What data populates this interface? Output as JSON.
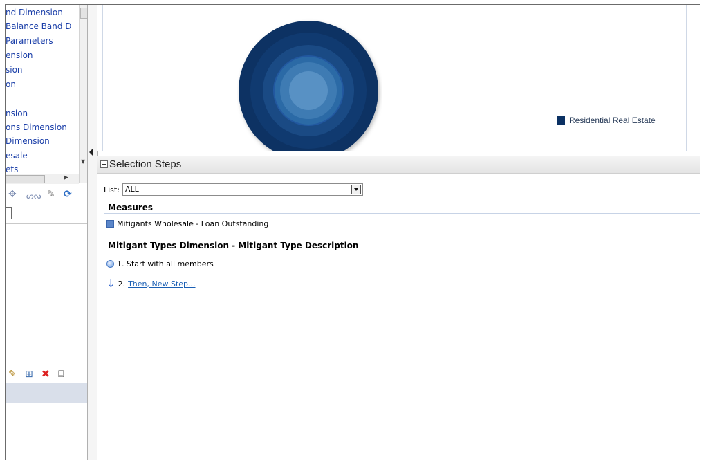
{
  "left_panel": {
    "tree_items": [
      "nd Dimension",
      "Balance Band D",
      "Parameters",
      "ension",
      "sion",
      "on",
      "",
      "nsion",
      "ons Dimension",
      "Dimension",
      "esale",
      "ets"
    ]
  },
  "chart_data": {
    "type": "pie",
    "categories": [
      "Residential Real Estate"
    ],
    "values": [
      100
    ],
    "legend_position": "right",
    "colors": [
      "#0b3163"
    ]
  },
  "legend": {
    "label": "Residential Real Estate"
  },
  "selection_steps": {
    "title": "Selection Steps",
    "list_label": "List:",
    "list_value": "ALL",
    "measures_heading": "Measures",
    "measure_item": "Mitigants Wholesale - Loan Outstanding",
    "dimension_heading": "Mitigant Types Dimension - Mitigant Type Description",
    "step1": "1. Start with all members",
    "step2_prefix": "2.",
    "step2_link": "Then, New Step..."
  },
  "colors": {
    "pie": "#0b3163",
    "accent": "#1a5fb4"
  }
}
